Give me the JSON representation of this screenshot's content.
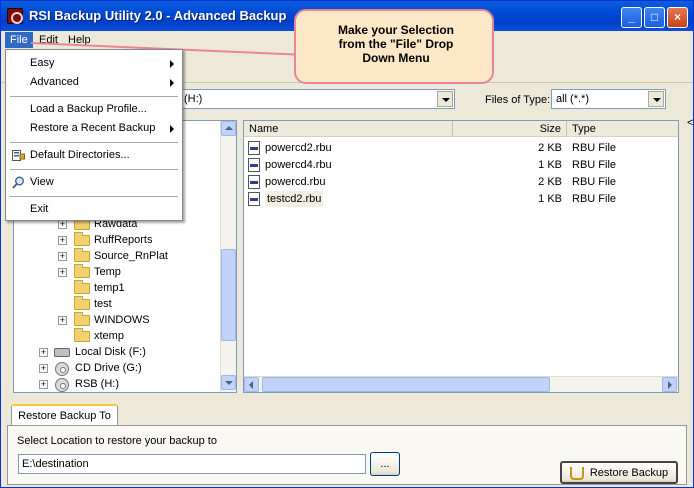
{
  "window": {
    "title": "RSI Backup Utility 2.0 - Advanced Backup",
    "controls": {
      "minimize": "_",
      "maximize": "□",
      "close": "×"
    }
  },
  "menubar": {
    "items": [
      "File",
      "Edit",
      "Help"
    ]
  },
  "file_menu": {
    "items": [
      {
        "label": "Easy",
        "submenu": true
      },
      {
        "label": "Advanced",
        "submenu": true
      },
      {
        "label": "Load a Backup Profile...",
        "submenu": false
      },
      {
        "label": "Restore a Recent Backup",
        "submenu": true
      },
      {
        "label": "Default Directories...",
        "submenu": false,
        "icon": "directories-icon"
      },
      {
        "label": "View",
        "submenu": false,
        "icon": "magnifier-icon"
      },
      {
        "label": "Exit",
        "submenu": false
      }
    ]
  },
  "callout": {
    "line1": "Make your Selection",
    "line2": "from the \"File\" Drop",
    "line3": "Down Menu",
    "fill": "#FCE8C7",
    "border": "#E8849B"
  },
  "location": {
    "value": "(H:)",
    "files_of_type_label": "Files of Type:",
    "files_of_type_value": "all (*.*)"
  },
  "tree": {
    "items": [
      {
        "label": "Rawdata",
        "expander": "+",
        "type": "folder"
      },
      {
        "label": "RuffReports",
        "expander": "+",
        "type": "folder"
      },
      {
        "label": "Source_RnPlat",
        "expander": "+",
        "type": "folder"
      },
      {
        "label": "Temp",
        "expander": "+",
        "type": "folder"
      },
      {
        "label": "temp1",
        "expander": "",
        "type": "folder"
      },
      {
        "label": "test",
        "expander": "",
        "type": "folder"
      },
      {
        "label": "WINDOWS",
        "expander": "+",
        "type": "folder"
      },
      {
        "label": "xtemp",
        "expander": "",
        "type": "folder"
      },
      {
        "label": "Local Disk (F:)",
        "expander": "+",
        "type": "disk"
      },
      {
        "label": "CD Drive (G:)",
        "expander": "+",
        "type": "cd"
      },
      {
        "label": "RSB (H:)",
        "expander": "+",
        "type": "cd"
      }
    ]
  },
  "filelist": {
    "columns": {
      "name": "Name",
      "size": "Size",
      "type": "Type"
    },
    "rows": [
      {
        "name": "powercd2.rbu",
        "size": "2 KB",
        "type": "RBU File"
      },
      {
        "name": "powercd4.rbu",
        "size": "1 KB",
        "type": "RBU File"
      },
      {
        "name": "powercd.rbu",
        "size": "2 KB",
        "type": "RBU File"
      },
      {
        "name": "testcd2.rbu",
        "size": "1 KB",
        "type": "RBU File"
      }
    ]
  },
  "restore": {
    "tab_label": "Restore Backup To",
    "prompt": "Select Location to restore your backup to",
    "path_value": "E:\\destination",
    "browse_label": "...",
    "button_label": "Restore Backup"
  }
}
